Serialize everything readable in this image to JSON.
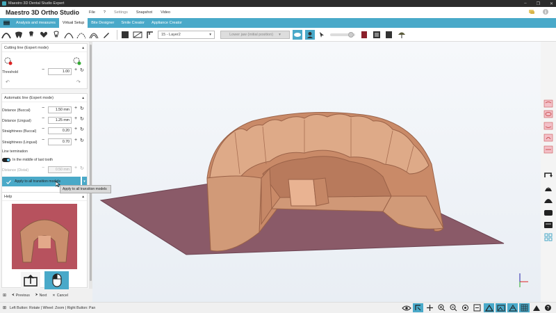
{
  "window": {
    "title": "Maestro 3D Dental Studio Expert",
    "controls": [
      "–",
      "❐",
      "✕"
    ]
  },
  "menubar": {
    "brand": "Maestro 3D Ortho Studio",
    "items": [
      {
        "label": "File",
        "dim": false
      },
      {
        "label": "?",
        "dim": false
      },
      {
        "label": "Settings",
        "dim": true
      },
      {
        "label": "Snapshot",
        "dim": false
      },
      {
        "label": "Video",
        "dim": false
      }
    ]
  },
  "tabs": [
    {
      "label": "Analysis and measures",
      "active": false
    },
    {
      "label": "Virtual Setup",
      "active": true
    },
    {
      "label": "Bite Designer",
      "active": false
    },
    {
      "label": "Smile Creator",
      "active": false
    },
    {
      "label": "Appliance Creator",
      "active": false
    }
  ],
  "toolbar": {
    "layer_select": "15 - Layer2",
    "jaw_select": "Lower jaw (initial position)"
  },
  "cutting_line": {
    "title": "Cutting line (Expert mode)",
    "threshold_label": "Threshold",
    "threshold_value": "1.00"
  },
  "automatic_line": {
    "title": "Automatic line (Expert mode)",
    "rows": [
      {
        "label": "Distance (Buccal)",
        "value": "1.50 mm"
      },
      {
        "label": "Distance (Lingual)",
        "value": "1.25 mm"
      },
      {
        "label": "Straightness (Buccal)",
        "value": "0.20"
      },
      {
        "label": "Straightness (Lingual)",
        "value": "0.70"
      }
    ],
    "line_termination_label": "Line termination",
    "toggle_label": "In the middle of last tooth",
    "distal_label": "Distance (Distal)",
    "distal_value": "0.50 mm",
    "apply_label": "Apply to all transition models",
    "tooltip": "Apply to all transition models"
  },
  "help": {
    "title": "Help"
  },
  "nav": {
    "previous": "Previous",
    "next": "Next",
    "cancel": "Cancel"
  },
  "status": {
    "text": "Left Button: Rotate | Wheel: Zoom | Right Button: Pan"
  },
  "colors": {
    "accent": "#49a9c9",
    "model": "#d9a07f",
    "base_plane": "#8a5a68"
  }
}
